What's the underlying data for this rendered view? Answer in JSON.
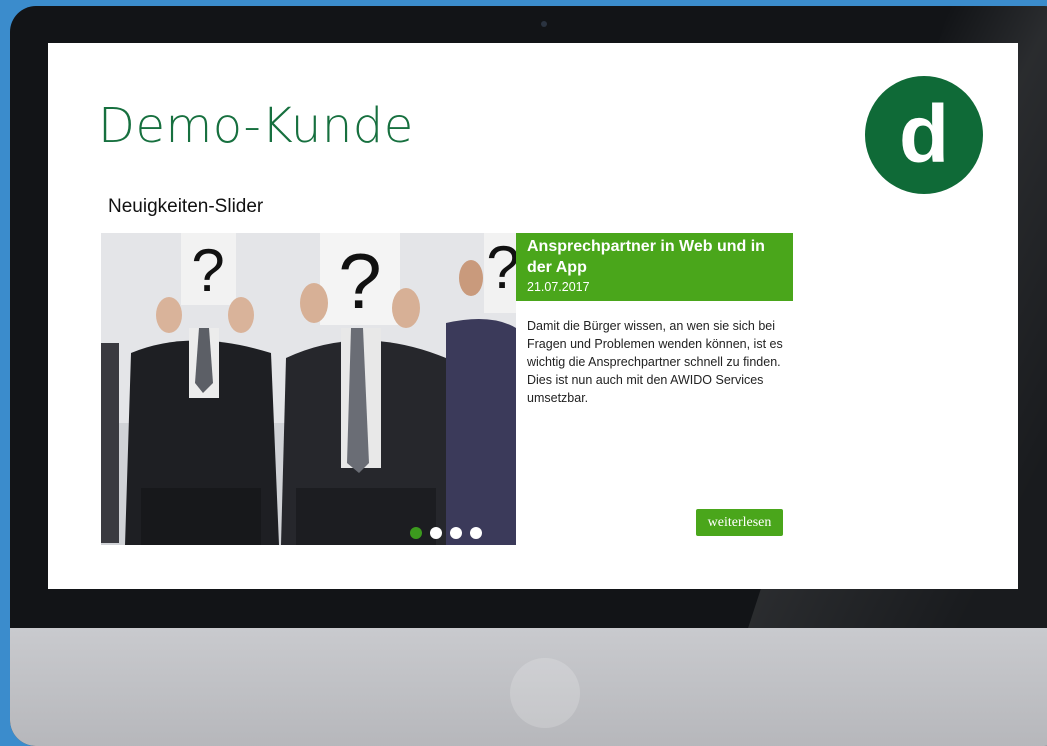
{
  "page": {
    "title": "Demo-Kunde",
    "logo_letter": "d",
    "brand_color": "#0f6a37",
    "accent_color": "#4aa61b"
  },
  "slider": {
    "heading": "Neuigkeiten-Slider",
    "image_icon": "people-holding-question-mark-signs",
    "active_slide": 1,
    "slide_count": 4,
    "current": {
      "title": "Ansprechpartner in Web und in der App",
      "date": "21.07.2017",
      "body": "Damit die Bürger wissen, an wen sie sich bei Fragen und Problemen wenden können, ist es wichtig die Ansprechpartner schnell zu finden. Dies ist nun auch mit den AWIDO Services umsetzbar.",
      "button_label": "weiterlesen"
    }
  }
}
